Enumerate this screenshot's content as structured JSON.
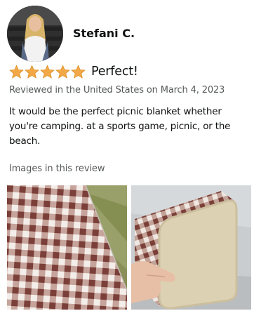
{
  "reviewer": {
    "name": "Stefani C.",
    "avatar_icon": "profile-photo"
  },
  "review": {
    "rating": 5,
    "rating_max": 5,
    "star_color": "#f3a847",
    "title": "Perfect!",
    "meta": "Reviewed in the United States on March 4, 2023",
    "body": "It would be the perfect picnic blanket whether you're camping. at a sports game, picnic, or the beach."
  },
  "images_section": {
    "heading": "Images in this review",
    "images": [
      {
        "icon": "checkered-blanket-on-grass-photo"
      },
      {
        "icon": "folded-blanket-in-hand-photo"
      }
    ]
  }
}
